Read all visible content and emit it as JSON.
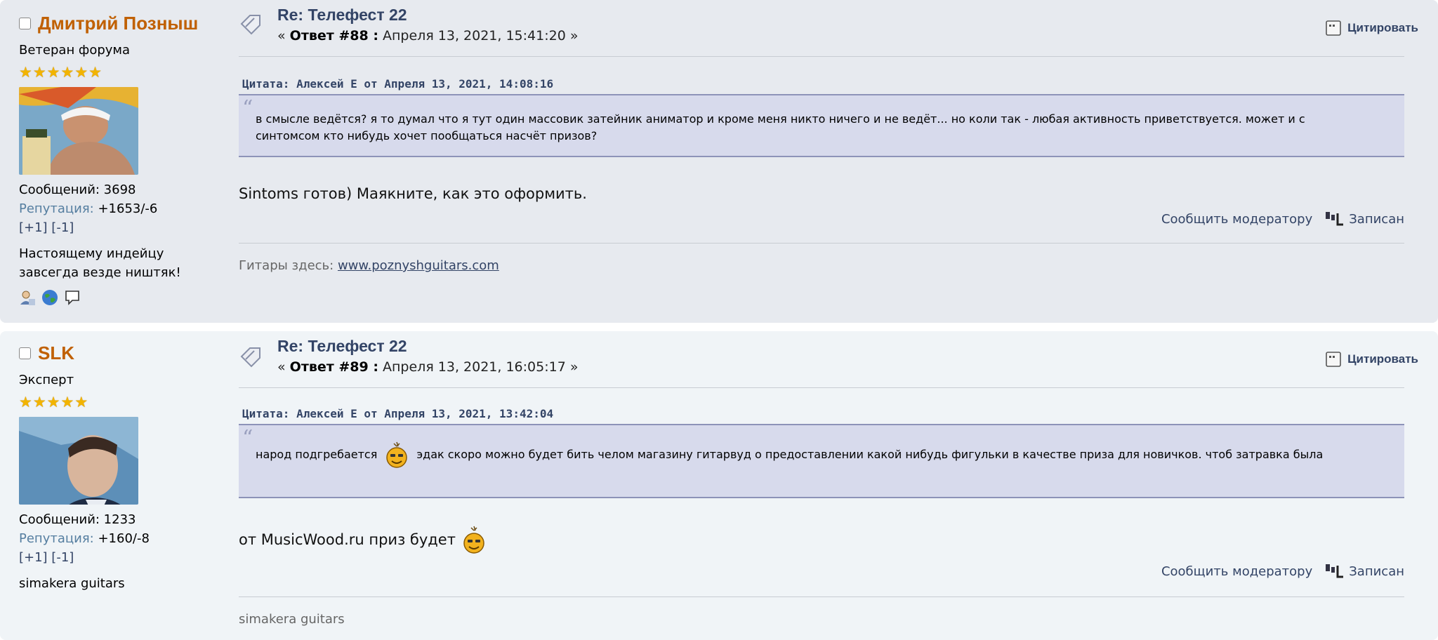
{
  "posts": [
    {
      "author": "Дмитрий Позныш",
      "rank": "Ветеран форума",
      "messages": "Сообщений: 3698",
      "rep_label": "Репутация:",
      "rep_value": "+1653/-6",
      "rep_links": "[+1] [-1]",
      "signature_line1": "Настоящему индейцу",
      "signature_line2": "завсегда везде ништяк!",
      "title": "Re: Телефест 22",
      "meta_prefix": "«",
      "meta_reply": "Ответ #88 :",
      "meta_date": "Апреля 13, 2021, 15:41:20 »",
      "quote_button": "Цитировать",
      "quote_header": "Цитата: Алексей Е от Апреля 13, 2021, 14:08:16",
      "quote_line1": "в смысле ведётся? я то думал что я тут один массовик затейник аниматор и кроме меня никто ничего и не ведёт... но коли так - любая активность приветствуется. может и с",
      "quote_line2": "синтомсом кто нибудь хочет пообщаться насчёт призов?",
      "body": "Sintoms готов) Маякните, как это оформить.",
      "report": "Сообщить модератору",
      "saved": "Записан",
      "sig_prefix": "Гитары здесь:",
      "sig_link": "www.poznyshguitars.com"
    },
    {
      "author": "SLK",
      "rank": "Эксперт",
      "messages": "Сообщений: 1233",
      "rep_label": "Репутация:",
      "rep_value": "+160/-8",
      "rep_links": "[+1] [-1]",
      "signature_line1": "simakera guitars",
      "title": "Re: Телефест 22",
      "meta_prefix": "«",
      "meta_reply": "Ответ #89 :",
      "meta_date": "Апреля 13, 2021, 16:05:17 »",
      "quote_button": "Цитировать",
      "quote_header": "Цитата: Алексей Е от Апреля 13, 2021, 13:42:04",
      "quote_part1": "народ подгребается",
      "quote_part2": "эдак скоро можно будет бить челом магазину гитарвуд о предоставлении какой нибудь фигульки в качестве приза для новичков. чтоб затравка была",
      "body": "от MusicWood.ru приз будет",
      "report": "Сообщить модератору",
      "saved": "Записан",
      "sig_text": "simakera guitars"
    }
  ]
}
